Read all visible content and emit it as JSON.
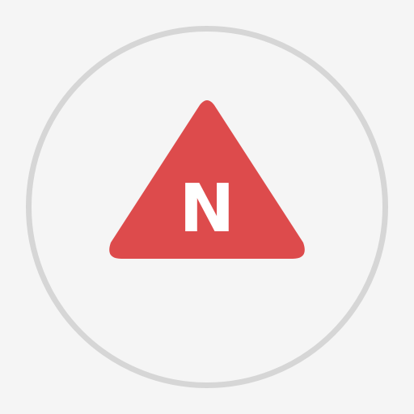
{
  "icon": {
    "letter": "N",
    "name": "north-compass-icon",
    "colors": {
      "background": "#f5f5f5",
      "ring": "#d6d6d6",
      "triangle": "#dd4b4c",
      "letter": "#ffffff"
    }
  }
}
